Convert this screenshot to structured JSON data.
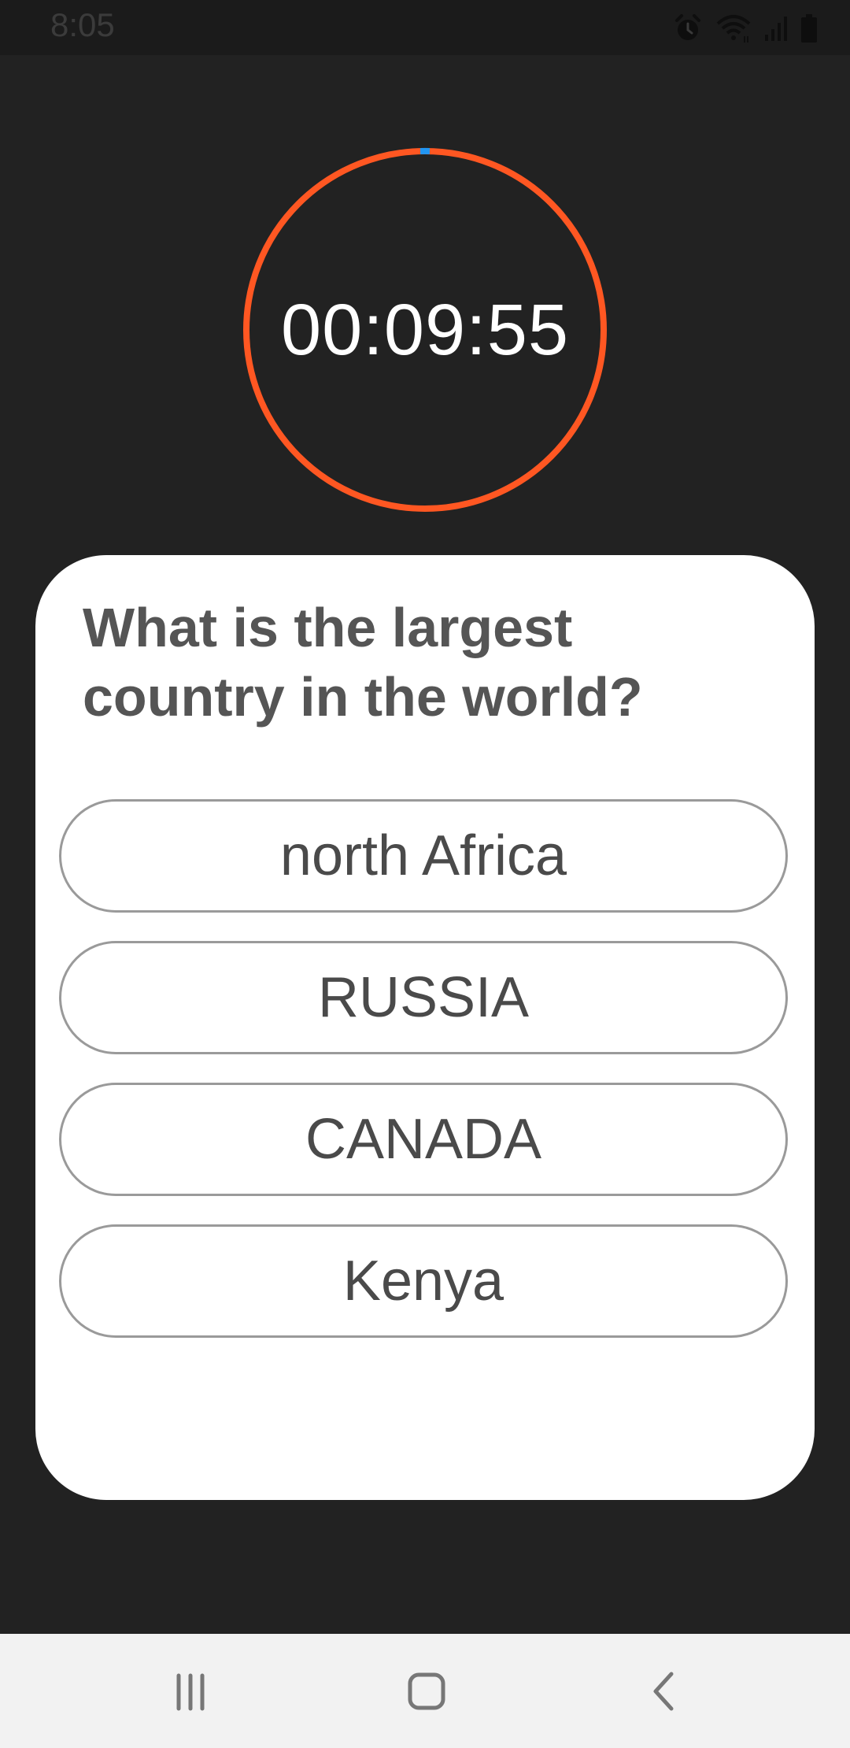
{
  "status_bar": {
    "time": "8:05",
    "icons": [
      "alarm-icon",
      "wifi-icon",
      "signal-icon",
      "battery-icon"
    ]
  },
  "timer": {
    "display": "00:09:55",
    "ring_color": "#ff5722",
    "progress_marker_color": "#2196f3"
  },
  "quiz": {
    "question": "What is the largest country in the world?",
    "answers": [
      "north Africa",
      "RUSSIA",
      "CANADA",
      "Kenya"
    ]
  },
  "nav_bar": {
    "buttons": [
      "recent-apps-icon",
      "home-icon",
      "back-icon"
    ]
  }
}
